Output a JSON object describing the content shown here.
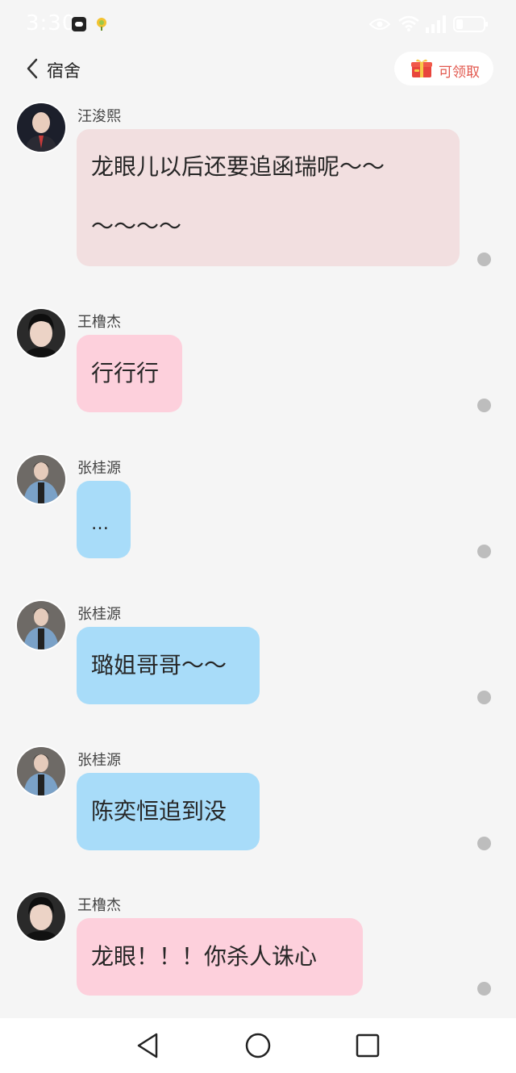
{
  "status_bar": {
    "time": "3:30",
    "icons": [
      "message-app-icon",
      "weather-app-icon",
      "eye-icon",
      "wifi-icon",
      "signal-icon",
      "battery-icon"
    ]
  },
  "header": {
    "title": "宿舍",
    "back_icon": "chevron-left-icon",
    "claim_label": "可领取",
    "claim_icon": "red-envelope-gift-icon"
  },
  "colors": {
    "background": "#f5f5f5",
    "bubble_wang_junxi": "#f2dfe0",
    "bubble_wang_lujie": "#fdd0dc",
    "bubble_zhang_guiyuan": "#a8dcf9",
    "claim_text": "#e2584e",
    "read_dot": "#bdbdbd"
  },
  "messages": [
    {
      "sender": "汪浚熙",
      "text_lines": [
        "龙眼儿以后还要追函瑞呢～～",
        "～～～～"
      ],
      "avatar": "avatar-dark-suit"
    },
    {
      "sender": "王橹杰",
      "text": "行行行",
      "avatar": "avatar-black-hair"
    },
    {
      "sender": "张桂源",
      "text": "…",
      "avatar": "avatar-denim-jacket"
    },
    {
      "sender": "张桂源",
      "text": "璐姐哥哥～～",
      "avatar": "avatar-denim-jacket"
    },
    {
      "sender": "张桂源",
      "text": "陈奕恒追到没",
      "avatar": "avatar-denim-jacket"
    },
    {
      "sender": "王橹杰",
      "text": "龙眼！！！你杀人诛心",
      "avatar": "avatar-black-hair"
    }
  ],
  "nav_bar": {
    "buttons": [
      "back-triangle-icon",
      "home-circle-icon",
      "recents-square-icon"
    ]
  }
}
